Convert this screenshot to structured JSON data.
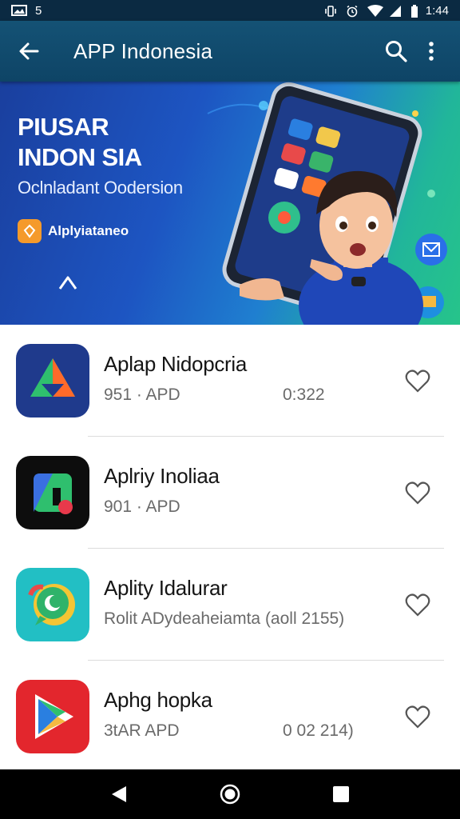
{
  "status_bar": {
    "left_icons": [
      "image-icon",
      "notification-badge-icon"
    ],
    "left_text": "5",
    "time": "1:44",
    "right_icons": [
      "vibrate-icon",
      "alarm-icon",
      "wifi-icon",
      "signal-icon",
      "battery-icon"
    ]
  },
  "app_bar": {
    "title": "APP Indonesia",
    "back_icon": "arrow-left-icon",
    "search_icon": "search-icon",
    "menu_icon": "more-vert-icon"
  },
  "banner": {
    "title_line1": "PIUSAR",
    "title_line2": "INDON SIA",
    "subtitle": "Oclnladant Oodersion",
    "pill_label": "Alplyiataneo",
    "chevron_icon": "chevron-up-icon"
  },
  "apps": [
    {
      "name": "Aplap Nidopcria",
      "meta": "951 · APD",
      "meta2": "0:322",
      "icon": "triangle-app-icon",
      "favorite": false
    },
    {
      "name": "Aplriy Inoliaa",
      "meta": "901 · APD",
      "meta2": "",
      "icon": "square-app-icon",
      "favorite": false
    },
    {
      "name": "Aplity Idalurar",
      "meta": "Rolit ADydeaheiamta (aoll 2155)",
      "meta2": "",
      "icon": "chat-app-icon",
      "favorite": false
    },
    {
      "name": "Aphg hopka",
      "meta": "3tAR APD",
      "meta2": "0 02 214)",
      "icon": "play-app-icon",
      "favorite": false
    }
  ],
  "nav_bar": {
    "back_icon": "nav-back-icon",
    "home_icon": "nav-home-icon",
    "recents_icon": "nav-recents-icon"
  },
  "colors": {
    "app_bar": "#145275",
    "status_bar": "#0b2a42",
    "banner_start": "#1a3f9e",
    "banner_end": "#26c48a",
    "text_primary": "#151515",
    "text_secondary": "#6a6a6a"
  }
}
